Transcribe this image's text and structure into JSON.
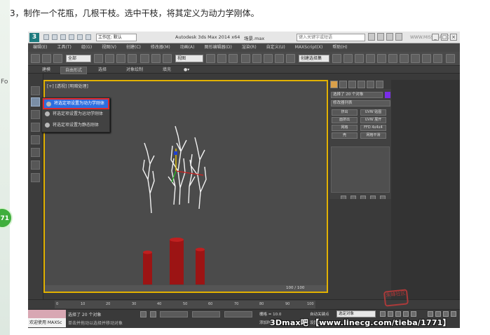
{
  "caption": "3，制作一个花瓶，几根干枝。选中干枝，将其定义为动力学刚体。",
  "left_edge": {
    "fragment": "Fo",
    "badge": "71"
  },
  "app": {
    "logo": "3",
    "workspace": "工作区: 默认",
    "title": "Autodesk 3ds Max  2014 x64",
    "scene": "场景.max",
    "search_placeholder": "键入关键字或短语",
    "watermark": "WWW.MISSYUAN.COM",
    "window_buttons": [
      "_",
      "□",
      "×"
    ]
  },
  "menubar": [
    "编辑(E)",
    "工具(T)",
    "组(G)",
    "视图(V)",
    "创建(C)",
    "修改器(M)",
    "动画(A)",
    "图形编辑器(D)",
    "渲染(R)",
    "自定义(U)",
    "MAXScript(X)",
    "帮助(H)"
  ],
  "toolbar": {
    "filter": "全部",
    "view": "视图",
    "named_sel": "创建选择集"
  },
  "ribbon": {
    "tabs": [
      "建模",
      "自由形式",
      "选择",
      "对象绘制",
      "填充"
    ],
    "active": "自由形式"
  },
  "viewport": {
    "label": "[+] [透视] [明暗处理]",
    "frame": "100 / 100"
  },
  "context_menu": {
    "items": [
      "将选定项设置为动力学刚体",
      "将选定项设置为运动学刚体",
      "将选定项设置为静态刚体"
    ],
    "selected_index": 0
  },
  "command_panel": {
    "object_name": "选择了 20 个对象",
    "modifier_list": "修改器列表",
    "buttons": [
      "挤出",
      "UVW 贴图",
      "面挤出",
      "UVW 展开",
      "网格",
      "FFD 4x4x4",
      "壳",
      "网格平滑"
    ]
  },
  "timeline": {
    "ticks": [
      "0",
      "10",
      "20",
      "30",
      "40",
      "50",
      "60",
      "70",
      "80",
      "90",
      "100"
    ]
  },
  "statusbar": {
    "welcome": "欢迎使用 MAXSc",
    "selection": "选择了 20 个对象",
    "hint": "单击并拖动以选择并移动对象",
    "grid": "栅格 = 10.0",
    "add_time": "添加时间标记",
    "autokey": "自动关键点",
    "setkey": "设置关键点",
    "selected_object": "选定对象"
  },
  "footer_watermark": "3Dmax吧 【www.linecg.com/tieba/1771】",
  "stamp": "朱峰社区"
}
